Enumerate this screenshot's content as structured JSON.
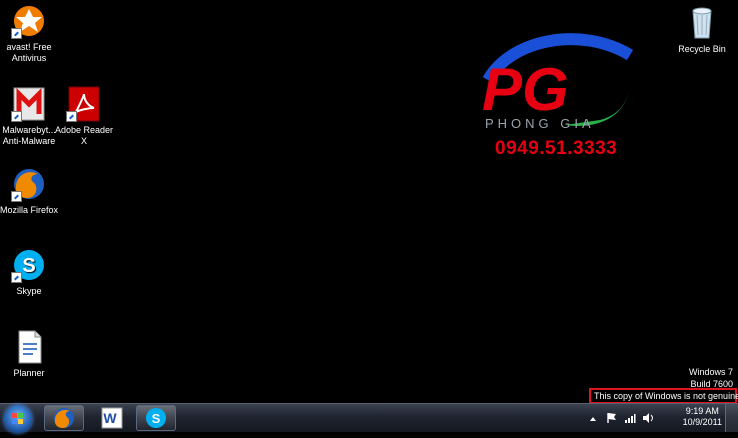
{
  "desktop": {
    "icons": [
      {
        "label": "avast! Free Antivirus",
        "icon": "avast-icon"
      },
      {
        "label": "Malwarebyt... Anti-Malware",
        "icon": "malwarebytes-icon"
      },
      {
        "label": "Adobe Reader X",
        "icon": "adobe-reader-icon"
      },
      {
        "label": "Mozilla Firefox",
        "icon": "firefox-icon"
      },
      {
        "label": "Skype",
        "icon": "skype-icon"
      },
      {
        "label": "Planner",
        "icon": "document-icon"
      },
      {
        "label": "Recycle Bin",
        "icon": "recycle-bin-icon"
      }
    ],
    "watermark": {
      "logo_letters": "PG",
      "logo_subtext": "PHONG GIA",
      "phone": "0949.51.3333",
      "colors": {
        "red": "#e60012",
        "blue": "#1a4fd8",
        "green": "#27b24a"
      }
    },
    "windows_version": {
      "line1": "Windows 7",
      "line2": "Build 7600",
      "notice": "This copy of Windows is not genuine"
    }
  },
  "taskbar": {
    "pinned": [
      {
        "app": "Firefox",
        "icon": "firefox-icon"
      },
      {
        "app": "Word",
        "icon": "word-icon"
      },
      {
        "app": "Skype",
        "icon": "skype-icon"
      }
    ],
    "tray": {
      "time": "9:19 AM",
      "date": "10/9/2011",
      "icons": [
        "chevron-up-icon",
        "flag-icon",
        "network-icon",
        "volume-icon"
      ]
    }
  }
}
